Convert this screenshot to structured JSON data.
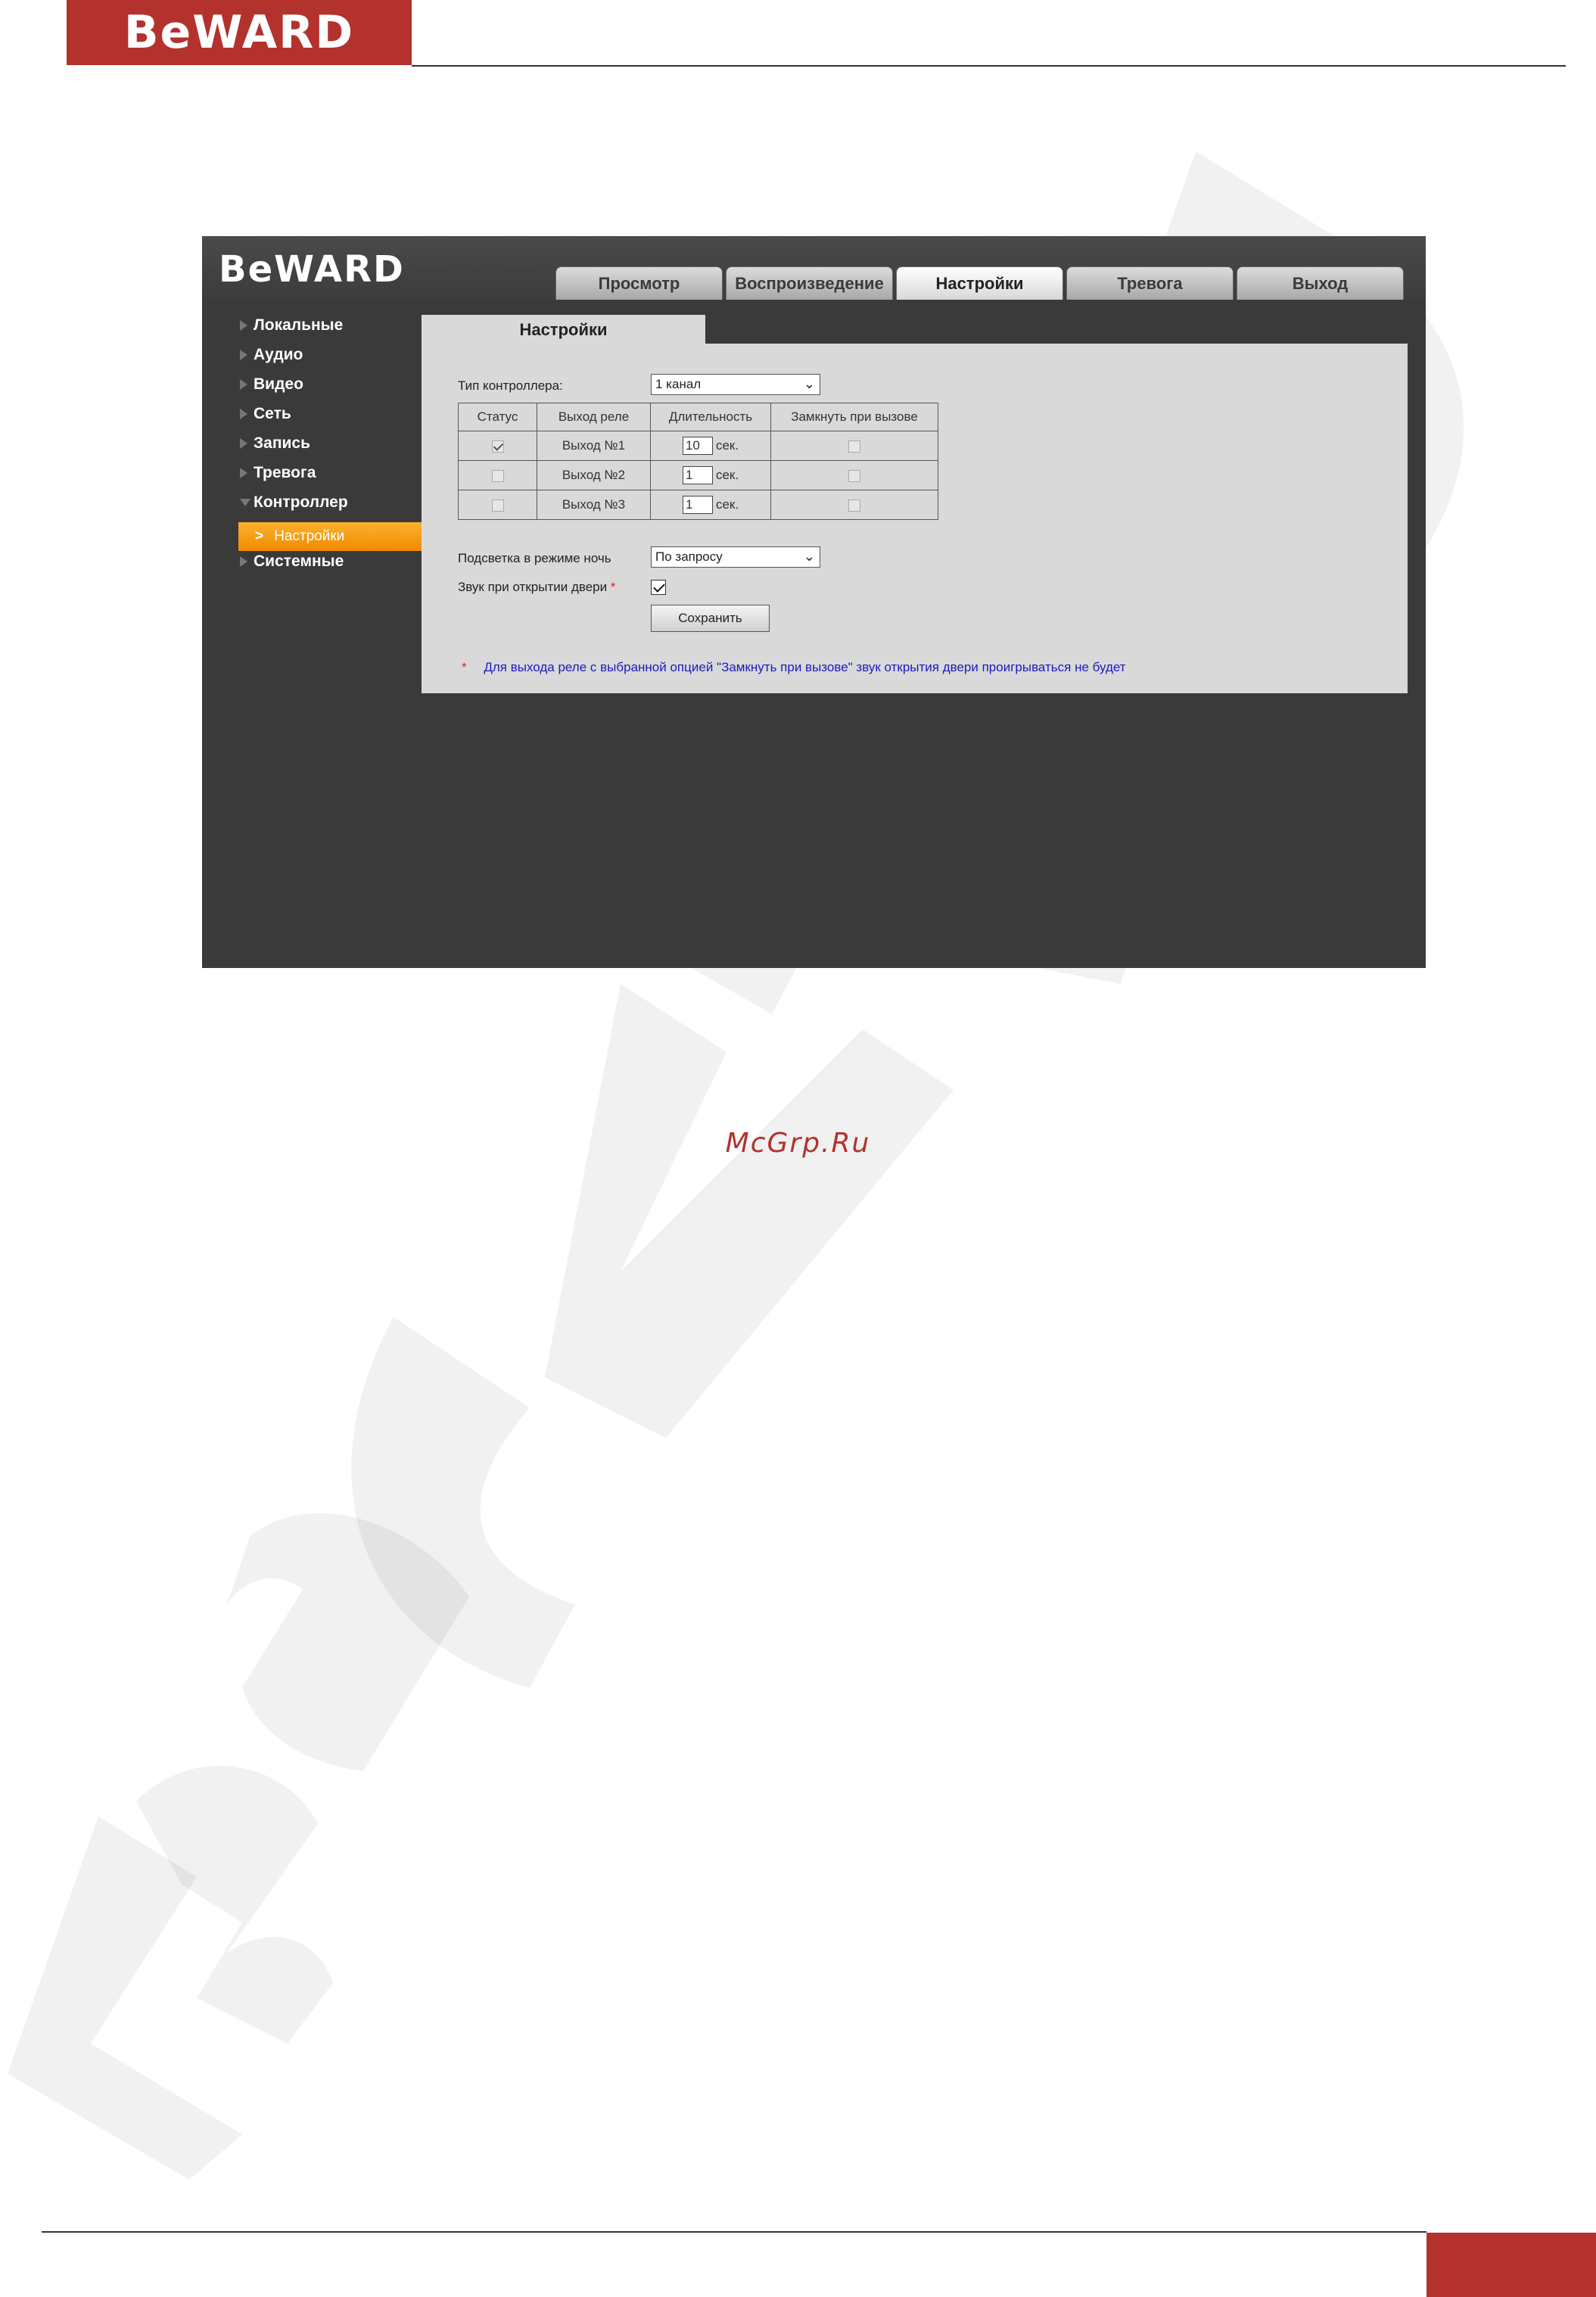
{
  "document": {
    "logo_text": "BeWARD",
    "watermark_text": "McGrp.Ru"
  },
  "ui": {
    "logo_text": "BeWARD",
    "tabs": [
      {
        "label": "Просмотр",
        "active": false
      },
      {
        "label": "Воспроизведение",
        "active": false
      },
      {
        "label": "Настройки",
        "active": true
      },
      {
        "label": "Тревога",
        "active": false
      },
      {
        "label": "Выход",
        "active": false
      }
    ],
    "sidebar": {
      "items": [
        {
          "label": "Локальные",
          "expanded": false
        },
        {
          "label": "Аудио",
          "expanded": false
        },
        {
          "label": "Видео",
          "expanded": false
        },
        {
          "label": "Сеть",
          "expanded": false
        },
        {
          "label": "Запись",
          "expanded": false
        },
        {
          "label": "Тревога",
          "expanded": false
        },
        {
          "label": "Контроллер",
          "expanded": true
        },
        {
          "label": "Системные",
          "expanded": false
        }
      ],
      "subitem": {
        "label": "Настройки",
        "chevron": ">"
      }
    },
    "panel": {
      "title": "Настройки",
      "controller_type_label": "Тип контроллера:",
      "controller_type_value": "1 канал",
      "table": {
        "headers": [
          "Статус",
          "Выход реле",
          "Длительность",
          "Замкнуть при вызове"
        ],
        "rows": [
          {
            "status": true,
            "output": "Выход №1",
            "duration": "10",
            "unit": "сек.",
            "close_on_call": false
          },
          {
            "status": false,
            "output": "Выход №2",
            "duration": "1",
            "unit": "сек.",
            "close_on_call": false
          },
          {
            "status": false,
            "output": "Выход №3",
            "duration": "1",
            "unit": "сек.",
            "close_on_call": false
          }
        ]
      },
      "night_light_label": "Подсветка в режиме ночь",
      "night_light_value": "По запросу",
      "door_sound_label": "Звук при открытии двери",
      "door_sound_required_mark": "*",
      "door_sound_checked": true,
      "save_label": "Сохранить",
      "note_star": "*",
      "note_text": "Для выхода реле с выбранной опцией \"Замкнуть при вызове\" звук открытия двери проигрываться не будет"
    }
  },
  "colors": {
    "brand_red": "#b3322e",
    "ui_dark": "#3a3a3a",
    "panel_gray": "#d9d9d9",
    "accent_orange": "#f5a000",
    "note_blue": "#1a1ac0"
  }
}
